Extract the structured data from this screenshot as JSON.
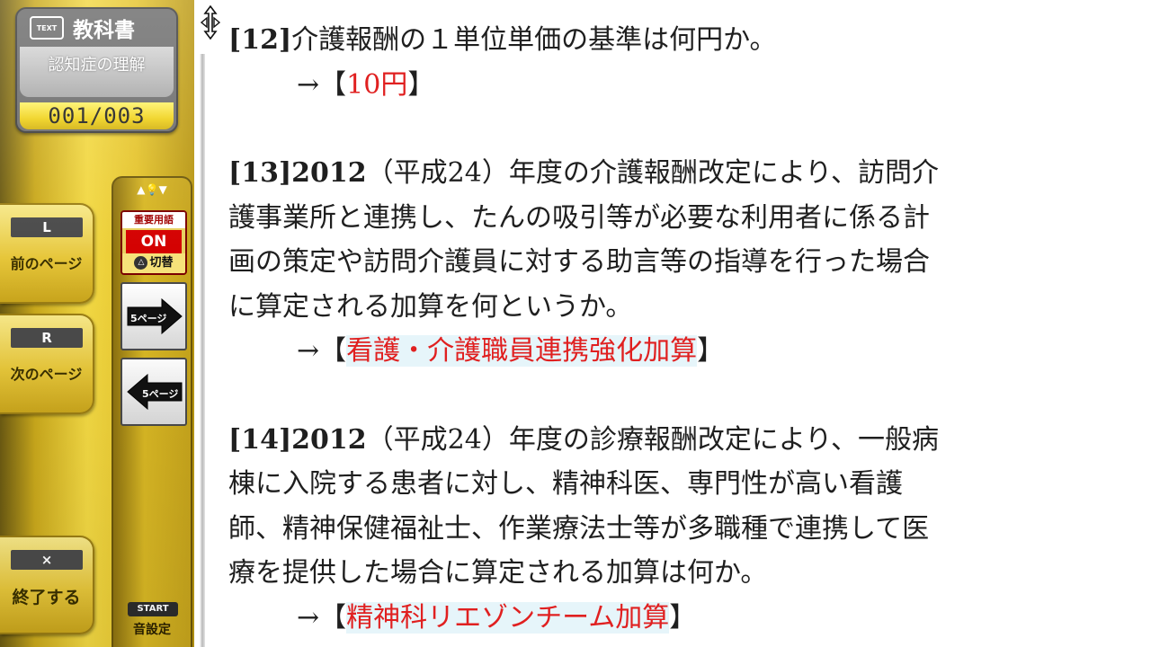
{
  "sidebar": {
    "textbook": {
      "icon_text": "TEXT",
      "title": "教科書",
      "subject": "認知症の理解",
      "page_counter": "001/003"
    },
    "prev_button": {
      "key": "L",
      "label": "前のページ"
    },
    "next_button": {
      "key": "R",
      "label": "次のページ"
    },
    "exit_button": {
      "key": "×",
      "label": "終了する"
    },
    "keyword_nav": "▲💡▼",
    "keyword_toggle": {
      "label": "重要用語",
      "state": "ON",
      "switch_key": "△",
      "switch_label": "切替"
    },
    "jump_forward": {
      "label": "5ページ"
    },
    "jump_back": {
      "label": "5ページ"
    },
    "start_key": "START",
    "sound_label": "音設定"
  },
  "colors": {
    "panel_gold": "#e5c42c",
    "answer_red": "#e02020",
    "answer_highlight": "#e6f5fa",
    "toggle_red": "#d40000"
  },
  "questions": [
    {
      "number": "[12]",
      "lines": [
        "介護報酬の１単位単価の基準は何円か。"
      ],
      "arrow": "→",
      "open_bracket": "【",
      "answer": "10円",
      "close_bracket": "】"
    },
    {
      "number": "[13]2012",
      "lines": [
        "（平成24）年度の介護報酬改定により、訪問介",
        "護事業所と連携し、たんの吸引等が必要な利用者に係る計",
        "画の策定や訪問介護員に対する助言等の指導を行った場合",
        "に算定される加算を何というか。"
      ],
      "arrow": "→",
      "open_bracket": "【",
      "answer": "看護・介護職員連携強化加算",
      "close_bracket": "】"
    },
    {
      "number": "[14]2012",
      "lines": [
        "（平成24）年度の診療報酬改定により、一般病",
        "棟に入院する患者に対し、精神科医、専門性が高い看護",
        "師、精神保健福祉士、作業療法士等が多職種で連携して医",
        "療を提供した場合に算定される加算は何か。"
      ],
      "arrow": "→",
      "open_bracket": "【",
      "answer": "精神科リエゾンチーム加算",
      "close_bracket": "】"
    }
  ]
}
